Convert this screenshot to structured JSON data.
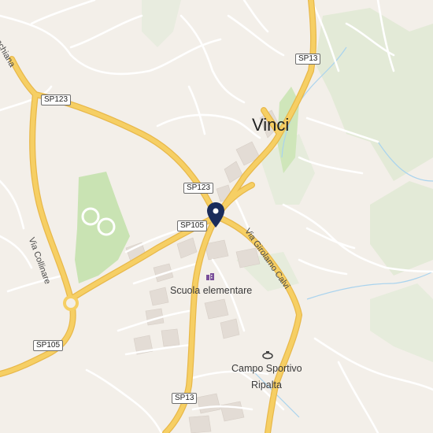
{
  "map": {
    "town_label": "Vinci",
    "road_shields": [
      {
        "id": "sp13-north",
        "text": "SP13"
      },
      {
        "id": "sp123-west",
        "text": "SP123"
      },
      {
        "id": "sp123-center",
        "text": "SP123"
      },
      {
        "id": "sp105-center",
        "text": "SP105"
      },
      {
        "id": "sp105-west",
        "text": "SP105"
      },
      {
        "id": "sp13-south",
        "text": "SP13"
      }
    ],
    "street_labels": {
      "via_collinare": "Via Collinare",
      "via_girolamo_calvi": "Via Girolamo Calvi",
      "top_left_partial": "nchiana"
    },
    "poi": {
      "school": "Scuola elementare",
      "stadium_line1": "Campo Sportivo",
      "stadium_line2": "Ripalta"
    },
    "icons": {
      "pin": "location-pin-icon",
      "school": "school-icon",
      "stadium": "stadium-icon"
    },
    "colors": {
      "background": "#f3efe9",
      "main_road": "#f6cf64",
      "road_casing": "#e8b84a",
      "minor_road": "#ffffff",
      "park": "#c9e3b3",
      "forest": "#dfe8d2",
      "building": "#e3dcd5",
      "pin": "#1a2c5b",
      "water": "#a9d3ee"
    }
  }
}
